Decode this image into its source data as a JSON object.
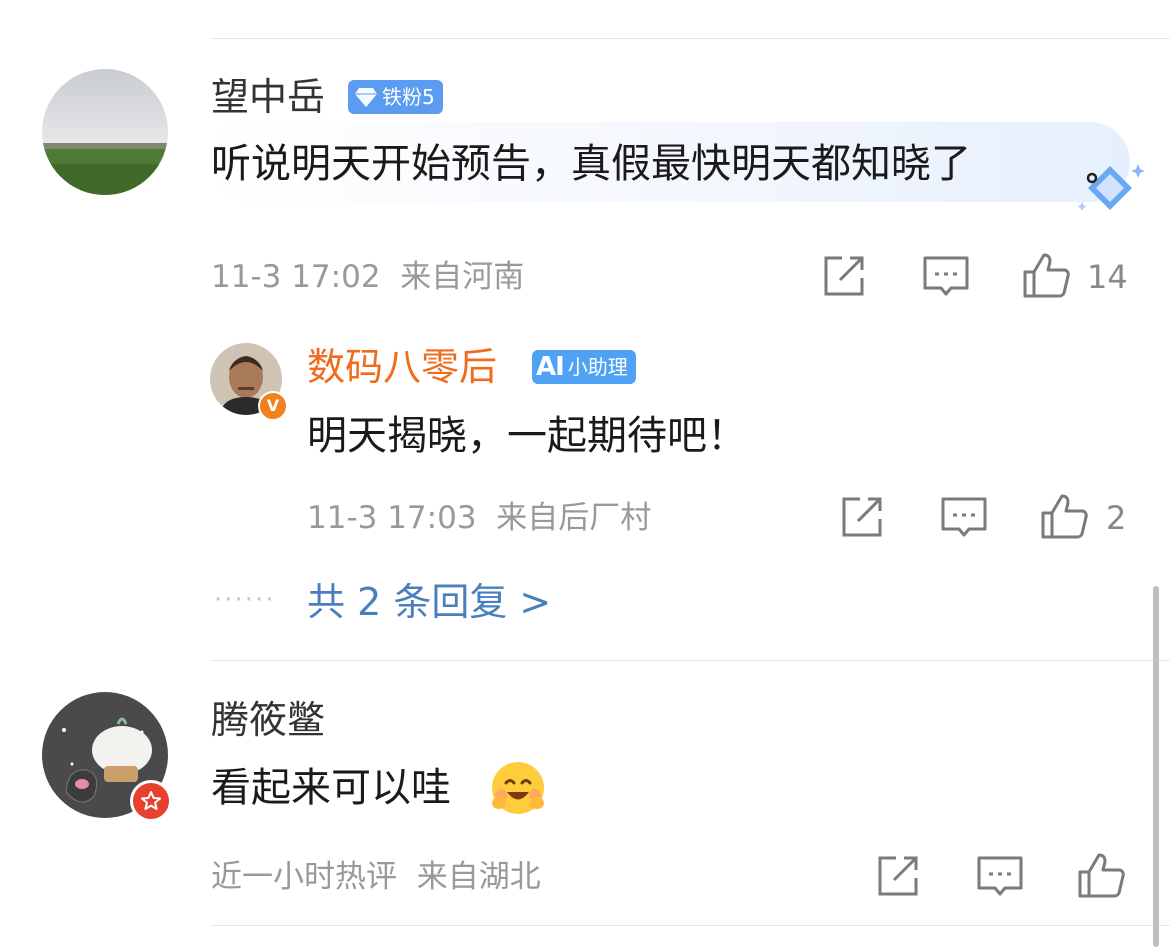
{
  "comments": [
    {
      "username": "望中岳",
      "badge": "铁粉5",
      "text": "听说明天开始预告，真假最快明天都知晓了",
      "time": "11-3 17:02",
      "location": "来自河南",
      "likes": "14",
      "reply": {
        "username": "数码八零后",
        "badge": "小助理",
        "badge_logo": "AI",
        "text": "明天揭晓，一起期待吧！",
        "time": "11-3 17:03",
        "location": "来自后厂村",
        "likes": "2"
      },
      "more_replies": "共 2 条回复 >",
      "dots": "······"
    },
    {
      "username": "腾筱鳖",
      "text": "看起来可以哇",
      "time": "近一小时热评",
      "location": "来自湖北",
      "likes": ""
    }
  ],
  "icons": {
    "share": "share-icon",
    "comment": "comment-icon",
    "like": "thumbs-up-icon",
    "verified": "verified-v-icon",
    "emoji": "smile-emoji-icon"
  },
  "colors": {
    "link": "#4a7fbd",
    "verified_name": "#f06b1b",
    "fan_badge": "#5b9cf2",
    "meta": "#999999"
  }
}
